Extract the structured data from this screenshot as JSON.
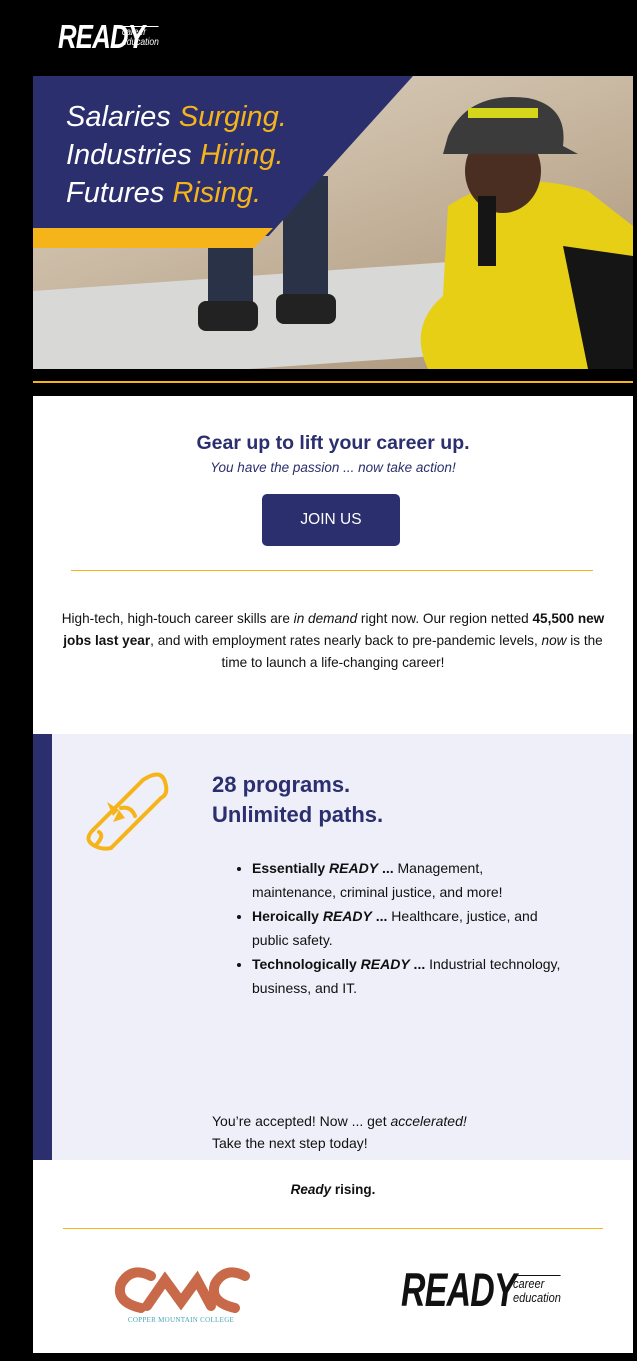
{
  "brand": {
    "name": "READY",
    "sub_line1": "career",
    "sub_line2": "education"
  },
  "hero": {
    "line1_a": "Salaries ",
    "line1_b": "Surging.",
    "line2_a": "Industries ",
    "line2_b": "Hiring.",
    "line3_a": "Futures ",
    "line3_b": "Rising."
  },
  "cta": {
    "headline": "Gear up to lift your career up.",
    "subhead": "You have the passion ... now take action!",
    "button_label": "JOIN US"
  },
  "intro": {
    "p1": "High-tech, high-touch career skills are ",
    "p1_em": "in demand",
    "p2": " right now. Our region netted ",
    "p2_strong": "45,500 new jobs last year",
    "p3": ", and with employment rates nearly back to pre-pandemic levels, ",
    "p3_em": "now",
    "p4": " is the time to launch a life-changing career!"
  },
  "programs": {
    "title_line1": "28 programs.",
    "title_line2": "Unlimited paths.",
    "items": [
      {
        "lead": "Essentially ",
        "ready": "READY",
        "dots": " ...",
        "rest": " Management, maintenance, criminal justice, and more!"
      },
      {
        "lead": "Heroically ",
        "ready": "READY",
        "dots": " ...",
        "rest": " Healthcare, justice, and public safety."
      },
      {
        "lead": "Technologically ",
        "ready": "READY",
        "dots": " ...",
        "rest": " Industrial technology, business, and IT."
      }
    ],
    "cta_line1_a": "You’re accepted! Now ... get ",
    "cta_line1_em": "accelerated!",
    "cta_line2": "Take the next step today!"
  },
  "footer": {
    "tagline_em": "Ready",
    "tagline_rest": " rising.",
    "college_name": "COPPER MOUNTAIN COLLEGE"
  },
  "colors": {
    "navy": "#2b2f6e",
    "gold": "#f5b41a",
    "lavender": "#efeff9",
    "copper": "#c8694a",
    "teal": "#47a7b5"
  }
}
